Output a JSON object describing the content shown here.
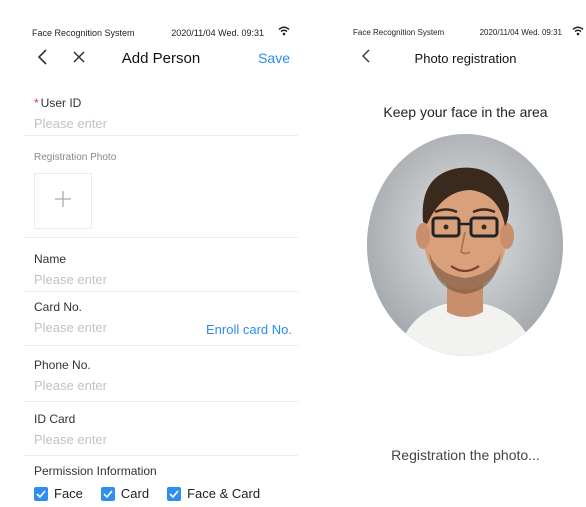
{
  "left_screen": {
    "status_bar": {
      "app_name": "Face Recognition System",
      "datetime": "2020/11/04  Wed.  09:31"
    },
    "nav": {
      "back_icon": "chevron-left-icon",
      "close_icon": "close-icon",
      "title": "Add Person",
      "save_label": "Save"
    },
    "fields": {
      "user_id": {
        "required_mark": "*",
        "label": "User ID",
        "placeholder": "Please enter"
      },
      "registration_photo": {
        "label": "Registration Photo",
        "icon": "plus-icon"
      },
      "name": {
        "label": "Name",
        "placeholder": "Please enter"
      },
      "card_no": {
        "label": "Card No.",
        "placeholder": "Please enter",
        "action": "Enroll card No."
      },
      "phone_no": {
        "label": "Phone No.",
        "placeholder": "Please enter"
      },
      "id_card": {
        "label": "ID Card",
        "placeholder": "Please enter"
      }
    },
    "permission": {
      "label": "Permission Information",
      "options": [
        {
          "label": "Face",
          "checked": true
        },
        {
          "label": "Card",
          "checked": true
        },
        {
          "label": "Face & Card",
          "checked": true
        }
      ]
    },
    "accent_color": "#2b8cf0"
  },
  "right_screen": {
    "status_bar": {
      "app_name": "Face Recognition System",
      "datetime": "2020/11/04  Wed.  09:31"
    },
    "nav": {
      "back_icon": "chevron-left-icon",
      "title": "Photo registration"
    },
    "prompt": "Keep your face in the area",
    "status_text": "Registration the photo..."
  }
}
